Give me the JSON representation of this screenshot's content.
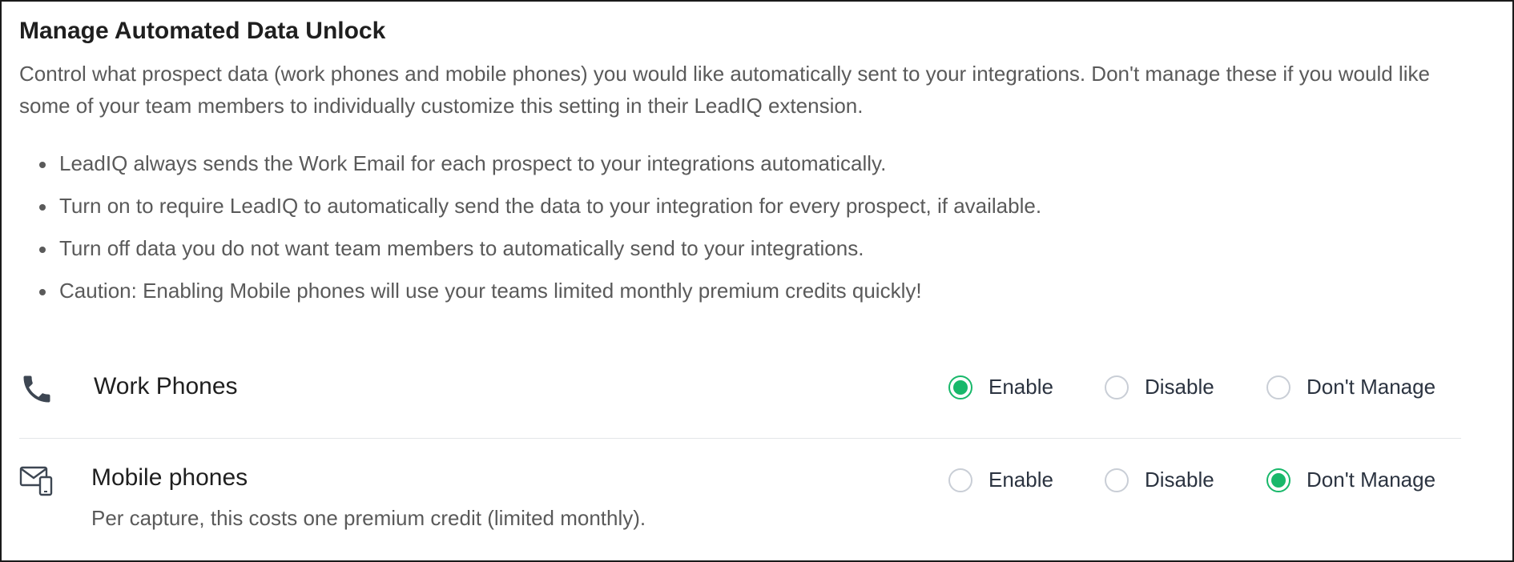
{
  "header": {
    "title": "Manage Automated Data Unlock",
    "description": "Control what prospect data (work phones and mobile phones) you would like automatically sent to your integrations. Don't manage these if you would like some of your team members to individually customize this setting in their LeadIQ extension."
  },
  "bullets": [
    "LeadIQ always sends the Work Email for each prospect to your integrations automatically.",
    "Turn on to require LeadIQ to automatically send the data to your integration for every prospect, if available.",
    "Turn off data you do not want team members to automatically send to your integrations.",
    "Caution: Enabling Mobile phones will use your teams limited monthly premium credits quickly!"
  ],
  "settings": {
    "work_phones": {
      "label": "Work Phones",
      "icon": "phone-icon",
      "options": [
        "Enable",
        "Disable",
        "Don't Manage"
      ],
      "selected": "Enable"
    },
    "mobile_phones": {
      "label": "Mobile phones",
      "subtext": "Per capture, this costs one premium credit (limited monthly).",
      "icon": "mobile-envelope-icon",
      "options": [
        "Enable",
        "Disable",
        "Don't Manage"
      ],
      "selected": "Don't Manage"
    }
  },
  "colors": {
    "accent": "#18b86a",
    "radio_border": "#c9ced6"
  }
}
